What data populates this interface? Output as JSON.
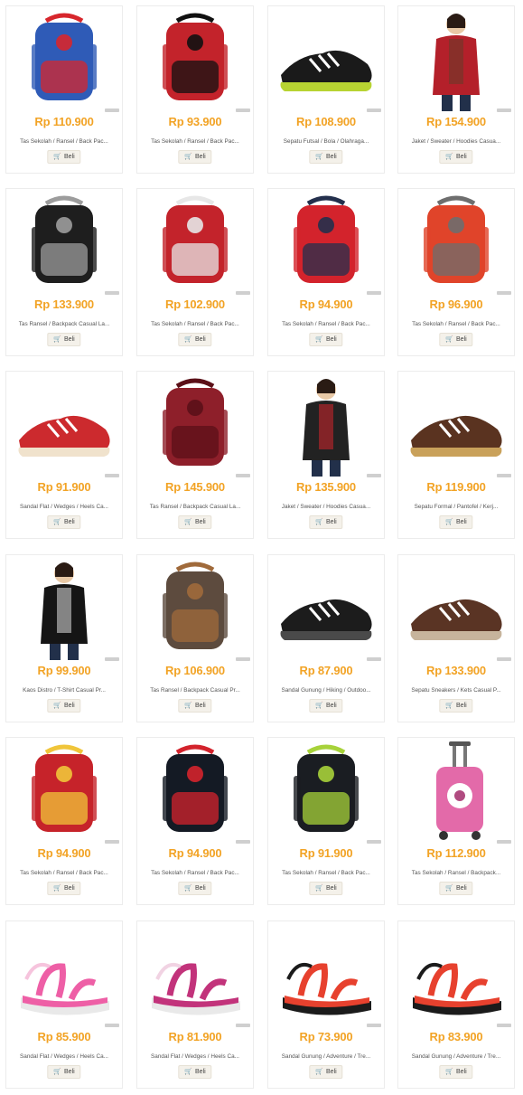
{
  "products": [
    {
      "price": "Rp 110.900",
      "title": "Tas Sekolah / Ransel / Back Pac...",
      "buy": "Beli",
      "image": "school-backpack-captain-shield",
      "color": "#2f5bb7",
      "accent": "#d7262c",
      "kind": "bag"
    },
    {
      "price": "Rp 93.900",
      "title": "Tas Sekolah / Ransel / Back Pac...",
      "buy": "Beli",
      "image": "school-backpack-spider",
      "color": "#c3232b",
      "accent": "#111111",
      "kind": "bag"
    },
    {
      "price": "Rp 108.900",
      "title": "Sepatu Futsal / Bola / Olahraga...",
      "buy": "Beli",
      "image": "futsal-shoe",
      "color": "#1a1a1a",
      "accent": "#b7d332",
      "kind": "shoe"
    },
    {
      "price": "Rp 154.900",
      "title": "Jaket / Sweater / Hoodies Casua...",
      "buy": "Beli",
      "image": "red-jacket-woman",
      "color": "#b4202a",
      "accent": "#6b3b2a",
      "kind": "person"
    },
    {
      "price": "Rp 133.900",
      "title": "Tas Ransel / Backpack Casual La...",
      "buy": "Beli",
      "image": "laptop-backpack-black-grey",
      "color": "#1e1e1e",
      "accent": "#9c9c9c",
      "kind": "bag"
    },
    {
      "price": "Rp 102.900",
      "title": "Tas Sekolah / Ransel / Back Pac...",
      "buy": "Beli",
      "image": "school-backpack-robot",
      "color": "#c3232b",
      "accent": "#e7e7e7",
      "kind": "bag"
    },
    {
      "price": "Rp 94.900",
      "title": "Tas Sekolah / Ransel / Back Pac...",
      "buy": "Beli",
      "image": "school-backpack-red-navy",
      "color": "#d3232c",
      "accent": "#24304d",
      "kind": "bag"
    },
    {
      "price": "Rp 96.900",
      "title": "Tas Sekolah / Ransel / Back Pac...",
      "buy": "Beli",
      "image": "school-backpack-ninja",
      "color": "#e0442a",
      "accent": "#6e6e6e",
      "kind": "bag"
    },
    {
      "price": "Rp 91.900",
      "title": "Sandal Flat / Wedges / Heels Ca...",
      "buy": "Beli",
      "image": "red-wedge-sandal",
      "color": "#cc2a2e",
      "accent": "#f0e2cc",
      "kind": "shoe"
    },
    {
      "price": "Rp 145.900",
      "title": "Tas Ransel / Backpack Casual La...",
      "buy": "Beli",
      "image": "maroon-backpack",
      "color": "#8e1f2a",
      "accent": "#5b1018",
      "kind": "bag"
    },
    {
      "price": "Rp 135.900",
      "title": "Jaket / Sweater / Hoodies Casua...",
      "buy": "Beli",
      "image": "black-red-jacket-woman",
      "color": "#222222",
      "accent": "#c4252c",
      "kind": "person"
    },
    {
      "price": "Rp 119.900",
      "title": "Sepatu Formal / Pantofel / Kerj...",
      "buy": "Beli",
      "image": "brown-heel-shoe",
      "color": "#5a3320",
      "accent": "#c9a15a",
      "kind": "shoe"
    },
    {
      "price": "Rp 99.900",
      "title": "Kaos Distro / T-Shirt Casual Pr...",
      "buy": "Beli",
      "image": "black-tshirt-men",
      "color": "#151515",
      "accent": "#cfcfcf",
      "kind": "person"
    },
    {
      "price": "Rp 106.900",
      "title": "Tas Ransel / Backpack Casual Pr...",
      "buy": "Beli",
      "image": "brown-canvas-backpack",
      "color": "#5d4b3e",
      "accent": "#a06a3b",
      "kind": "bag"
    },
    {
      "price": "Rp 87.900",
      "title": "Sandal Gunung / Hiking / Outdoo...",
      "buy": "Beli",
      "image": "black-hiking-sandal",
      "color": "#1c1c1c",
      "accent": "#4a4a4a",
      "kind": "shoe"
    },
    {
      "price": "Rp 133.900",
      "title": "Sepatu Sneakers / Kets Casual P...",
      "buy": "Beli",
      "image": "brown-suede-sneaker",
      "color": "#5a3424",
      "accent": "#c7b49c",
      "kind": "shoe"
    },
    {
      "price": "Rp 94.900",
      "title": "Tas Sekolah / Ransel / Back Pac...",
      "buy": "Beli",
      "image": "school-backpack-lego-ninja",
      "color": "#c6232a",
      "accent": "#f0c53a",
      "kind": "bag"
    },
    {
      "price": "Rp 94.900",
      "title": "Tas Sekolah / Ransel / Back Pac...",
      "buy": "Beli",
      "image": "black-backpack-red-tag",
      "color": "#141a24",
      "accent": "#d3232c",
      "kind": "bag"
    },
    {
      "price": "Rp 91.900",
      "title": "Tas Sekolah / Ransel / Back Pac...",
      "buy": "Beli",
      "image": "black-backpack-green-trim",
      "color": "#1a1d22",
      "accent": "#a7d23a",
      "kind": "bag"
    },
    {
      "price": "Rp 112.900",
      "title": "Tas Sekolah / Ransel / Backpack...",
      "buy": "Beli",
      "image": "pink-trolley-backpack",
      "color": "#e36aa9",
      "accent": "#b04b80",
      "kind": "trolley"
    },
    {
      "price": "Rp 85.900",
      "title": "Sandal Flat / Wedges / Heels Ca...",
      "buy": "Beli",
      "image": "pink-wedge-sandal",
      "color": "#ee5fa6",
      "accent": "#f6c4dd",
      "kind": "sandal"
    },
    {
      "price": "Rp 81.900",
      "title": "Sandal Flat / Wedges / Heels Ca...",
      "buy": "Beli",
      "image": "magenta-flat-sandal",
      "color": "#c2337b",
      "accent": "#f1d3e3",
      "kind": "sandal"
    },
    {
      "price": "Rp 73.900",
      "title": "Sandal Gunung / Adventure / Tre...",
      "buy": "Beli",
      "image": "red-black-adventure-sandal",
      "color": "#e7412e",
      "accent": "#1b1b1b",
      "kind": "sandal"
    },
    {
      "price": "Rp 83.900",
      "title": "Sandal Gunung / Adventure / Tre...",
      "buy": "Beli",
      "image": "red-black-adventure-sandal-2",
      "color": "#e7412e",
      "accent": "#1b1b1b",
      "kind": "sandal"
    }
  ],
  "colors": {
    "price": "#f2a325",
    "border": "#ececec",
    "button_bg": "#f4f1ea"
  },
  "cart_icon": "shopping-cart-icon"
}
